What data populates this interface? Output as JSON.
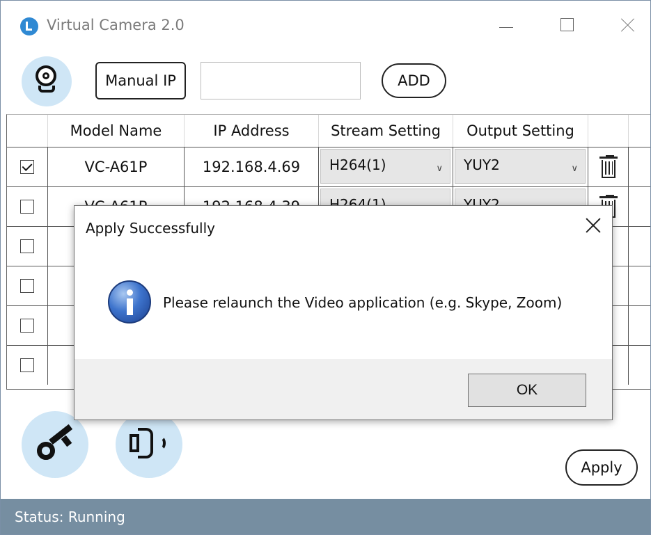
{
  "window": {
    "title": "Virtual Camera 2.0",
    "controls": [
      "minimize",
      "maximize",
      "close"
    ]
  },
  "toolbar": {
    "camera_icon": "webcam-icon",
    "manual_ip_label": "Manual IP",
    "ip_input_value": "",
    "add_label": "ADD"
  },
  "table": {
    "columns": [
      "",
      "Model Name",
      "IP Address",
      "Stream Setting",
      "Output Setting",
      ""
    ],
    "rows": [
      {
        "checked": true,
        "model": "VC-A61P",
        "ip": "192.168.4.69",
        "stream": "H264(1)",
        "output": "YUY2"
      },
      {
        "checked": false,
        "model": "VC-A61P",
        "ip": "192.168.4.39",
        "stream": "H264(1)",
        "output": "YUY2"
      },
      {
        "checked": false,
        "model": "",
        "ip": "",
        "stream": "",
        "output": ""
      },
      {
        "checked": false,
        "model": "",
        "ip": "",
        "stream": "",
        "output": ""
      },
      {
        "checked": false,
        "model": "",
        "ip": "",
        "stream": "",
        "output": ""
      },
      {
        "checked": false,
        "model": "",
        "ip": "",
        "stream": "",
        "output": ""
      }
    ]
  },
  "footer": {
    "key_icon": "key-icon",
    "speaker_icon": "speaker-icon",
    "apply_label": "Apply"
  },
  "status": {
    "text": "Status: Running"
  },
  "dialog": {
    "title": "Apply Successfully",
    "icon": "info-icon",
    "message": "Please relaunch the Video application (e.g. Skype, Zoom)",
    "ok_label": "OK"
  },
  "colors": {
    "status_bar": "#768ea1",
    "icon_circle": "#cfe6f6",
    "logo": "#2f89d3"
  }
}
